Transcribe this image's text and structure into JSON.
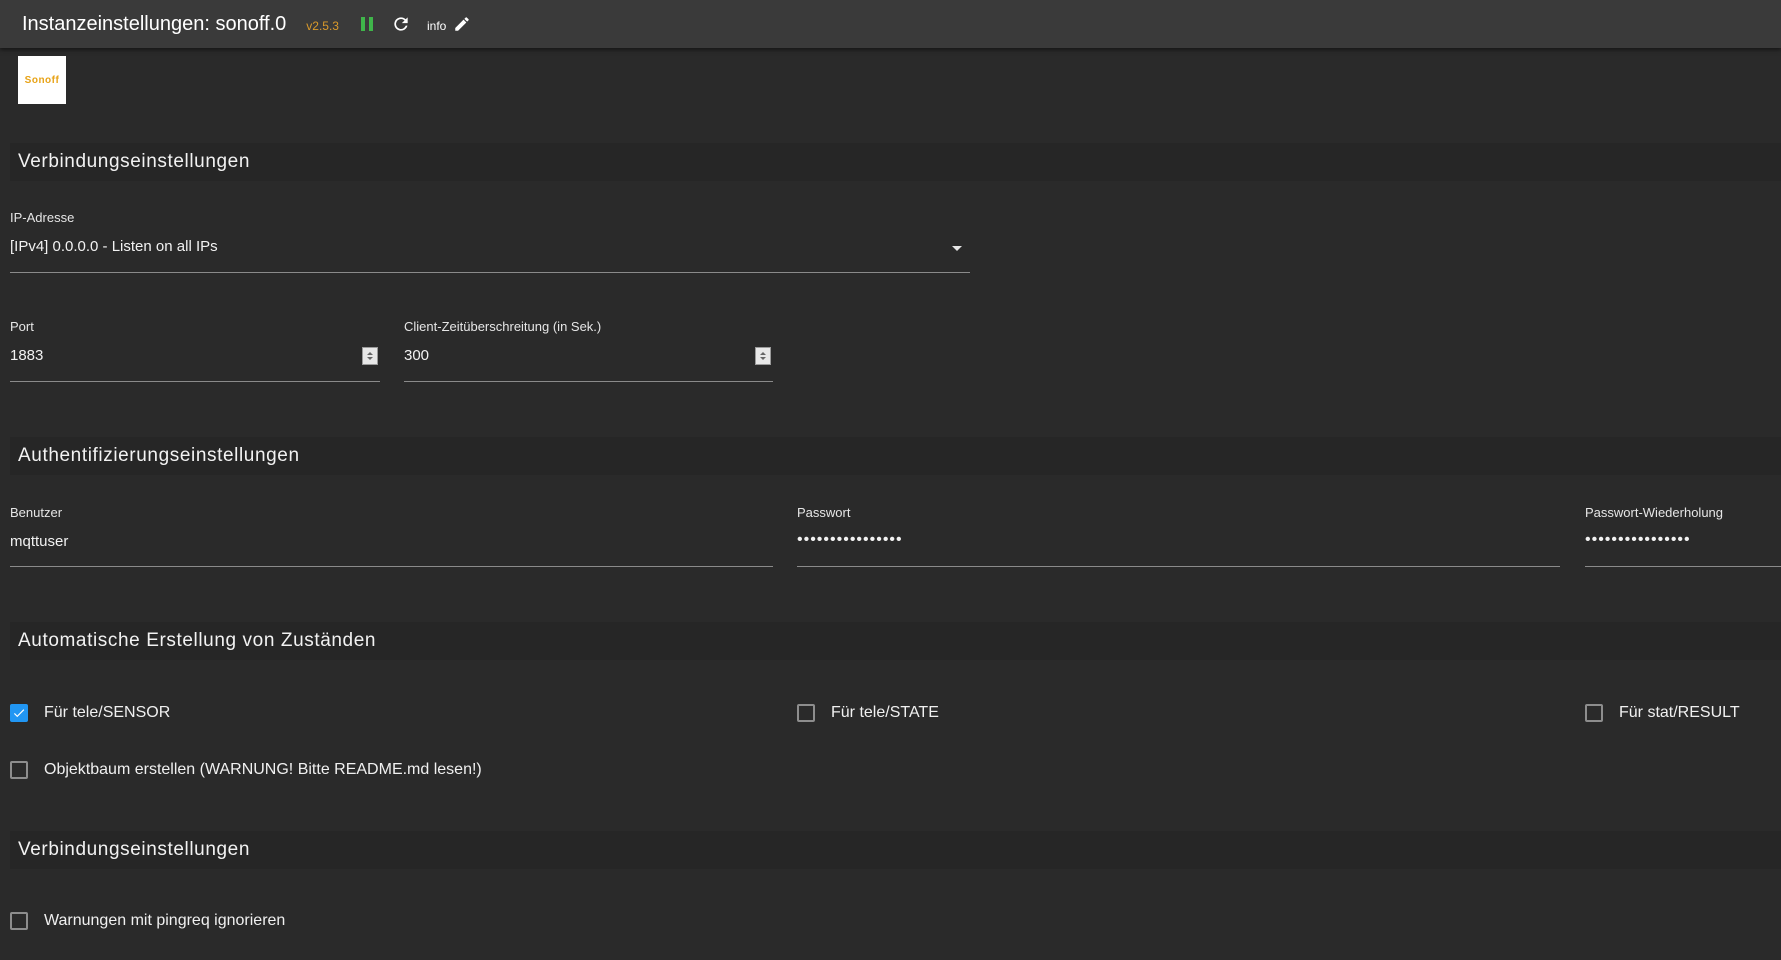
{
  "header": {
    "title": "Instanzeinstellungen: sonoff.0",
    "version": "v2.5.3",
    "info_label": "info"
  },
  "logo": {
    "text": "Sonoff"
  },
  "sections": {
    "connection": "Verbindungseinstellungen",
    "auth": "Authentifizierungseinstellungen",
    "auto_states": "Automatische Erstellung von Zuständen",
    "connection2": "Verbindungseinstellungen"
  },
  "fields": {
    "ip": {
      "label": "IP-Adresse",
      "value": "[IPv4] 0.0.0.0 - Listen on all IPs"
    },
    "port": {
      "label": "Port",
      "value": "1883"
    },
    "timeout": {
      "label": "Client-Zeitüberschreitung (in Sek.)",
      "value": "300"
    },
    "user": {
      "label": "Benutzer",
      "value": "mqttuser"
    },
    "password": {
      "label": "Passwort",
      "value": "••••••••••••••••"
    },
    "password_repeat": {
      "label": "Passwort-Wiederholung",
      "value": "••••••••••••••••"
    }
  },
  "checkboxes": {
    "tele_sensor": {
      "label": "Für tele/SENSOR",
      "checked": true
    },
    "tele_state": {
      "label": "Für tele/STATE",
      "checked": false
    },
    "stat_result": {
      "label": "Für stat/RESULT",
      "checked": false
    },
    "object_tree": {
      "label": "Objektbaum erstellen (WARNUNG! Bitte README.md lesen!)",
      "checked": false
    },
    "pingreq": {
      "label": "Warnungen mit pingreq ignorieren",
      "checked": false
    }
  },
  "colors": {
    "accent": "#2196f3",
    "version": "#d99a2b",
    "pause": "#3fb54a",
    "logo_text": "#e8a317"
  }
}
